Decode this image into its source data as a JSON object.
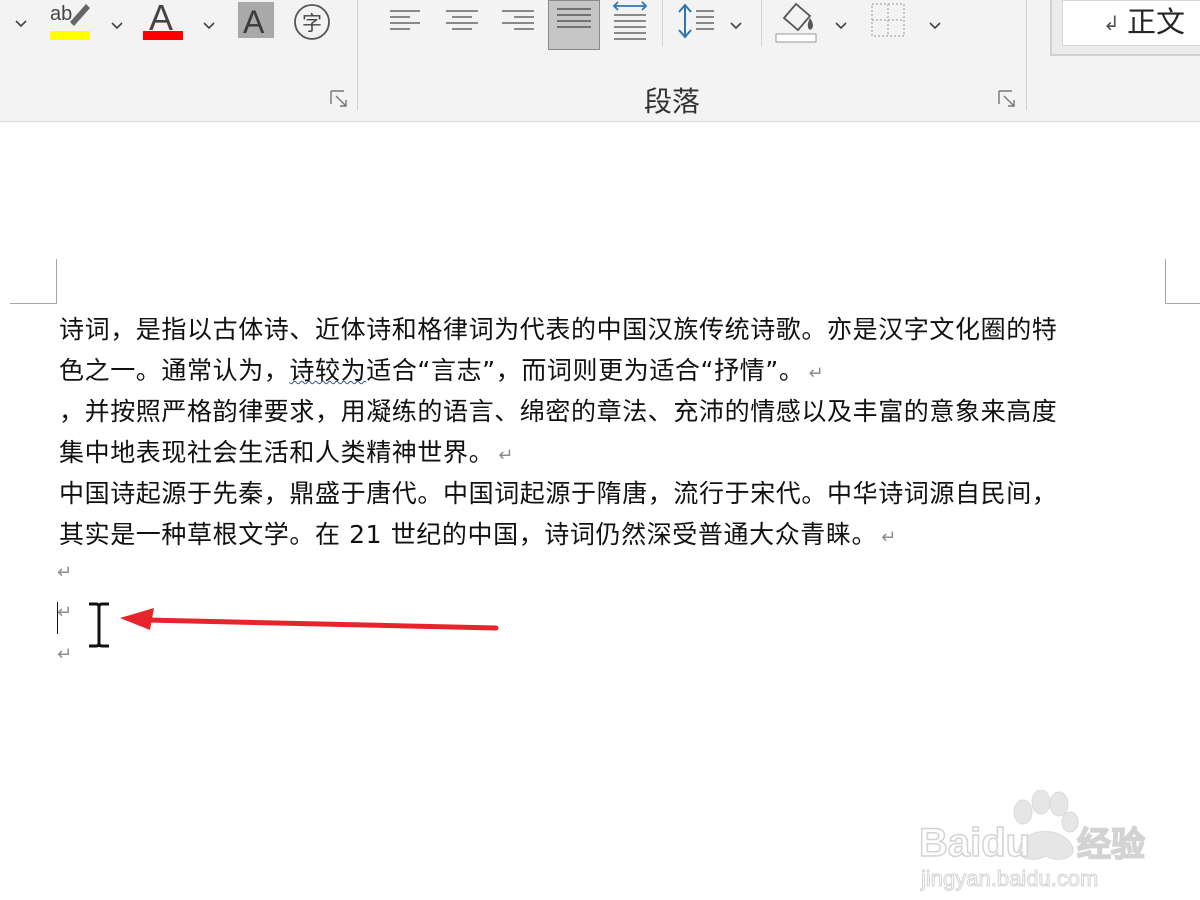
{
  "ribbon": {
    "font_group": {
      "highlight_glyph": "ab",
      "font_color_glyph": "A",
      "text_effect_glyph": "A",
      "phonetic_glyph": "字",
      "highlight_color": "#ffff00",
      "font_color": "#ff0000"
    },
    "paragraph_group": {
      "label": "段落",
      "icons": [
        "align-left-icon",
        "align-center-icon",
        "align-right-icon",
        "justify-icon",
        "distributed-icon",
        "line-spacing-icon",
        "shading-icon",
        "borders-icon"
      ]
    },
    "styles": {
      "current_style": "正文",
      "style_mark": "↲"
    }
  },
  "document": {
    "paragraphs": [
      {
        "line1": "诗词，是指以古体诗、近体诗和格律词为代表的中国汉族传统诗歌。亦是汉字文化圈的特",
        "line2_before": "色之一。通常认为，",
        "line2_flagged": "诗较为",
        "line2_after": "适合“言志”，而词则更为适合“抒情”。"
      },
      {
        "line1": "，并按照严格韵律要求，用凝练的语言、绵密的章法、充沛的情感以及丰富的意象来高度",
        "line2": "集中地表现社会生活和人类精神世界。"
      },
      {
        "line1": "中国诗起源于先秦，鼎盛于唐代。中国词起源于隋唐，流行于宋代。中华诗词源自民间，",
        "line2": "其实是一种草根文学。在 21 世纪的中国，诗词仍然深受普通大众青睐。"
      }
    ],
    "paragraph_mark": "↵"
  },
  "annotation": {
    "arrow_color": "#e5242b"
  },
  "watermark": {
    "brand": "Baidu",
    "cn": "经验",
    "url": "jingyan.baidu.com"
  }
}
